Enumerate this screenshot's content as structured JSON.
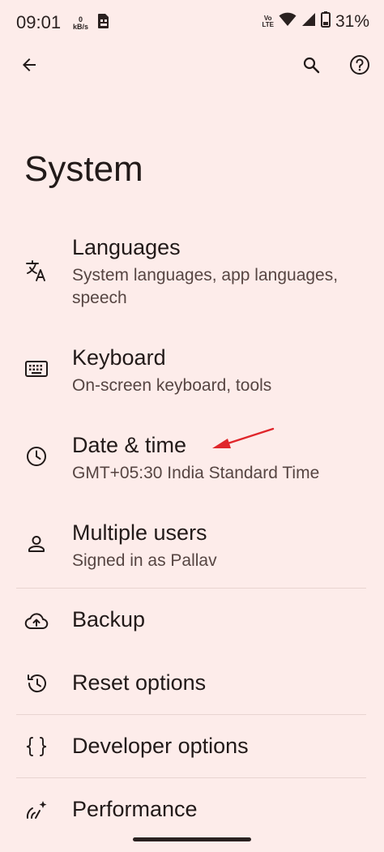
{
  "status_bar": {
    "time": "09:01",
    "data_rate_value": "0",
    "data_rate_unit": "kB/s",
    "volte_top": "Vo",
    "volte_bottom": "LTE",
    "battery": "31%"
  },
  "page": {
    "title": "System"
  },
  "items": [
    {
      "title": "Languages",
      "subtitle": "System languages, app languages, speech",
      "icon": "translate-icon"
    },
    {
      "title": "Keyboard",
      "subtitle": "On-screen keyboard, tools",
      "icon": "keyboard-icon"
    },
    {
      "title": "Date & time",
      "subtitle": "GMT+05:30 India Standard Time",
      "icon": "clock-icon"
    },
    {
      "title": "Multiple users",
      "subtitle": "Signed in as Pallav",
      "icon": "person-icon"
    },
    {
      "title": "Backup",
      "icon": "cloud-upload-icon"
    },
    {
      "title": "Reset options",
      "icon": "history-icon"
    },
    {
      "title": "Developer options",
      "icon": "braces-icon"
    },
    {
      "title": "Performance",
      "icon": "performance-icon"
    }
  ],
  "colors": {
    "background": "#fdecea",
    "text_primary": "#221a19",
    "text_secondary": "#564542",
    "annotation_arrow": "#e0262b"
  }
}
